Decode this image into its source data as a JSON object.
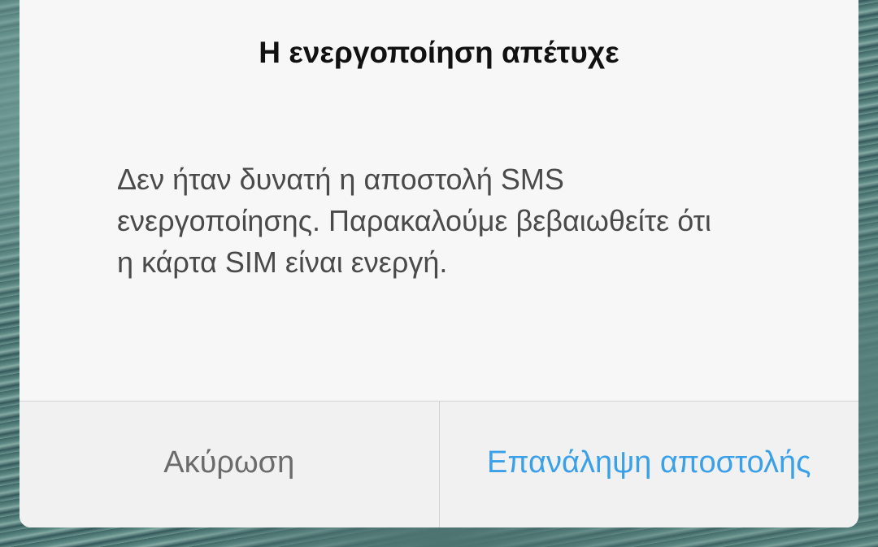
{
  "dialog": {
    "title": "Η ενεργοποίηση απέτυχε",
    "message": "Δεν ήταν δυνατή η αποστολή SMS ενεργοποίησης. Παρακαλούμε βεβαιωθείτε ότι η κάρτα SIM είναι ενεργή.",
    "buttons": {
      "cancel_label": "Ακύρωση",
      "retry_label": "Επανάληψη αποστολής"
    }
  },
  "colors": {
    "dialog_background": "#f7f7f7",
    "button_bar_background": "#f1f1f1",
    "title_text": "#111111",
    "message_text": "#4a4a4a",
    "cancel_text": "#6b6b6b",
    "accent": "#3aa0e8",
    "divider": "#d2d2d2"
  }
}
